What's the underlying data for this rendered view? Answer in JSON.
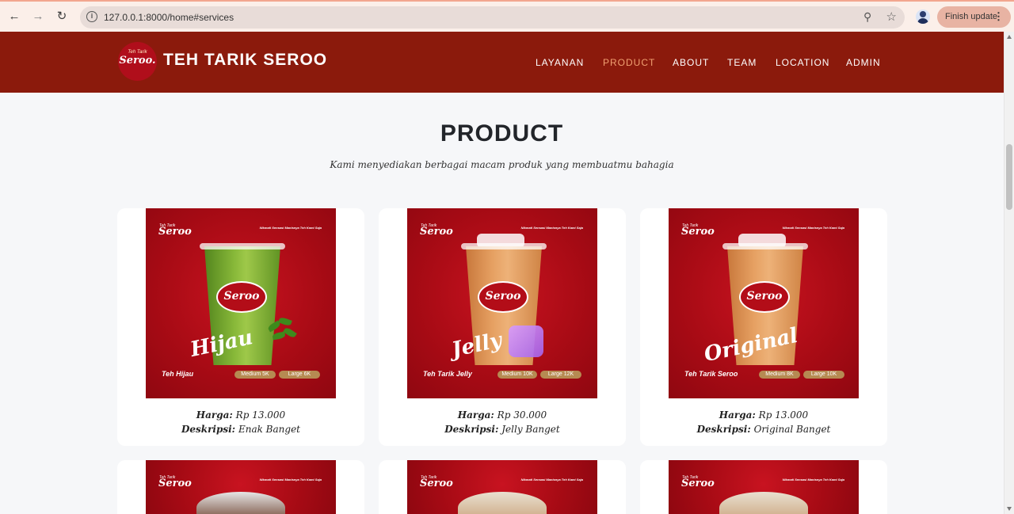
{
  "browser": {
    "url": "127.0.0.1:8000/home#services",
    "profile_button": "Finish update"
  },
  "header": {
    "logo_small": "Teh Tarik",
    "logo_main": "Seroo.",
    "brand": "TEH TARIK SEROO",
    "menu": [
      "LAYANAN",
      "PRODUCT",
      "ABOUT",
      "TEAM",
      "LOCATION",
      "ADMIN"
    ],
    "active_menu": "PRODUCT",
    "colors": {
      "header_bg": "#8b1a0c",
      "active": "#f0a071"
    }
  },
  "section": {
    "title": "PRODUCT",
    "subtitle": "Kami menyediakan berbagai macam produk yang membuatmu bahagia"
  },
  "image_text": {
    "brand_small": "Teh Tarik",
    "brand": "Seroo",
    "tagline": "Nikmati Sensasi Manisnya Teh Kami Saja"
  },
  "products": [
    {
      "script": "Hijau",
      "name": "Teh Hijau",
      "medium": "Medium 5K",
      "large": "Large 6K",
      "price_label": "Harga:",
      "price": "Rp 13.000",
      "desc_label": "Deskripsi:",
      "desc": "Enak Banget"
    },
    {
      "script": "Jelly",
      "name": "Teh Tarik Jelly",
      "medium": "Medium 10K",
      "large": "Large 12K",
      "price_label": "Harga:",
      "price": "Rp 30.000",
      "desc_label": "Deskripsi:",
      "desc": "Jelly Banget"
    },
    {
      "script": "Original",
      "name": "Teh Tarik Seroo",
      "medium": "Medium 8K",
      "large": "Large 10K",
      "price_label": "Harga:",
      "price": "Rp 13.000",
      "desc_label": "Deskripsi:",
      "desc": "Original Banget"
    }
  ]
}
